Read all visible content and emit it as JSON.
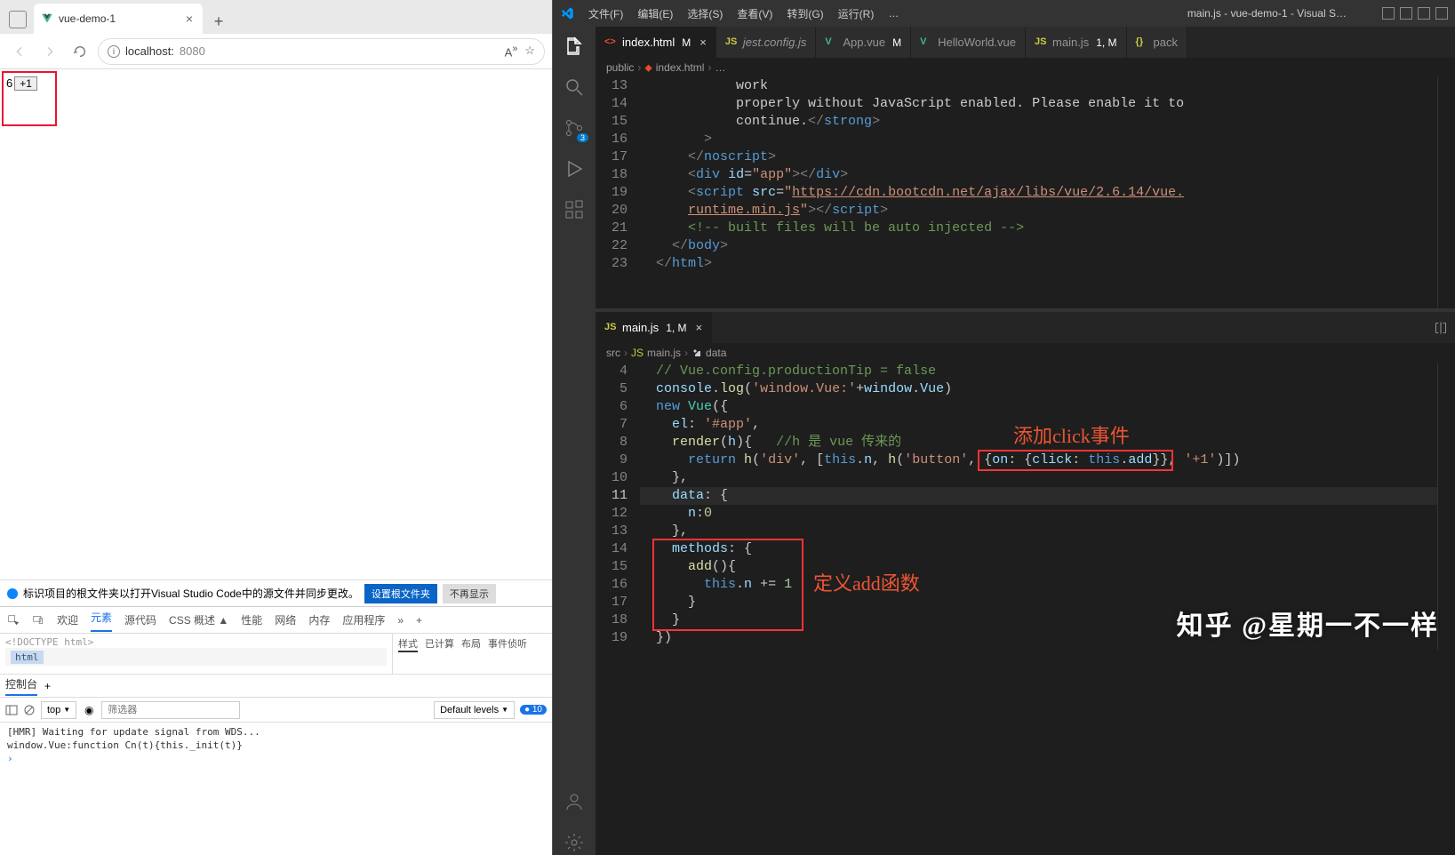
{
  "browser": {
    "tab_title": "vue-demo-1",
    "url_host": "localhost:",
    "url_port": "8080",
    "page_number": "6",
    "button_label": "+1",
    "info_text": "标识项目的根文件夹以打开Visual Studio Code中的源文件并同步更改。",
    "info_btn1": "设置根文件夹",
    "info_btn2": "不再显示",
    "devtabs": [
      "欢迎",
      "元素",
      "源代码",
      "CSS 概述 ▲",
      "性能",
      "网络",
      "内存",
      "应用程序"
    ],
    "doctype": "<!DOCTYPE html>",
    "breadcrumb": "html",
    "style_tabs": [
      "样式",
      "已计算",
      "布局",
      "事件侦听"
    ],
    "console_tab": "控制台",
    "top_filter": "top",
    "filter_placeholder": "筛选器",
    "levels": "Default levels",
    "issue_count": "10",
    "console_line1": "[HMR] Waiting for update signal from WDS...",
    "console_line2": "window.Vue:function Cn(t){this._init(t)}"
  },
  "vscode": {
    "menu": [
      "文件(F)",
      "编辑(E)",
      "选择(S)",
      "查看(V)",
      "转到(G)",
      "运行(R)",
      "…"
    ],
    "title": "main.js - vue-demo-1 - Visual S…",
    "scm_badge": "3",
    "pane1": {
      "tabs": [
        {
          "name": "index.html",
          "icon": "html",
          "modified": "M",
          "active": true,
          "close": true
        },
        {
          "name": "jest.config.js",
          "icon": "js",
          "italic": true
        },
        {
          "name": "App.vue",
          "icon": "vue",
          "modified": "M"
        },
        {
          "name": "HelloWorld.vue",
          "icon": "vue"
        },
        {
          "name": "main.js",
          "icon": "js",
          "modified": "1, M"
        },
        {
          "name": "pack",
          "icon": "json"
        }
      ],
      "breadcrumb": [
        "public",
        "index.html",
        "…"
      ],
      "lines": [
        {
          "n": 13,
          "html": "            work"
        },
        {
          "n": 14,
          "html": "            properly without JavaScript enabled. Please enable it to"
        },
        {
          "n": 15,
          "html": "            continue.<span class='c-pun'>&lt;/</span><span class='c-tag'>strong</span><span class='c-pun'>&gt;</span>"
        },
        {
          "n": 16,
          "html": "        <span class='c-pun'>&gt;</span>"
        },
        {
          "n": 17,
          "html": "      <span class='c-pun'>&lt;/</span><span class='c-tag'>noscript</span><span class='c-pun'>&gt;</span>"
        },
        {
          "n": 18,
          "html": "      <span class='c-pun'>&lt;</span><span class='c-tag'>div</span> <span class='c-attr'>id</span>=<span class='c-str'>\"app\"</span><span class='c-pun'>&gt;&lt;/</span><span class='c-tag'>div</span><span class='c-pun'>&gt;</span>"
        },
        {
          "n": 19,
          "html": "      <span class='c-pun'>&lt;</span><span class='c-tag'>script</span> <span class='c-attr'>src</span>=<span class='c-str'>\"<u>https://cdn.bootcdn.net/ajax/libs/vue/2.6.14/vue.</u></span>"
        },
        {
          "n": "",
          "html": "      <span class='c-str'><u>runtime.min.js</u>\"</span><span class='c-pun'>&gt;&lt;/</span><span class='c-tag'>script</span><span class='c-pun'>&gt;</span>"
        },
        {
          "n": 20,
          "html": "      <span class='c-cm'>&lt;!-- built files will be auto injected --&gt;</span>"
        },
        {
          "n": 21,
          "html": "    <span class='c-pun'>&lt;/</span><span class='c-tag'>body</span><span class='c-pun'>&gt;</span>"
        },
        {
          "n": 22,
          "html": "  <span class='c-pun'>&lt;/</span><span class='c-tag'>html</span><span class='c-pun'>&gt;</span>"
        },
        {
          "n": 23,
          "html": ""
        }
      ]
    },
    "pane2": {
      "tabs": [
        {
          "name": "main.js",
          "icon": "js",
          "modified": "1, M",
          "active": true,
          "close": true
        }
      ],
      "breadcrumb": [
        "src",
        "main.js",
        "data"
      ],
      "lines": [
        {
          "n": 4,
          "html": "  <span class='c-cm'>// Vue.config.productionTip = false</span>"
        },
        {
          "n": 5,
          "html": "  <span class='c-prop'>console</span>.<span class='c-fn'>log</span>(<span class='c-str'>'window.Vue:'</span>+<span class='c-prop'>window</span>.<span class='c-prop'>Vue</span>)"
        },
        {
          "n": 6,
          "html": "  <span class='c-kw'>new</span> <span class='c-cls'>Vue</span>({"
        },
        {
          "n": 7,
          "html": "    <span class='c-prop'>el</span>: <span class='c-str'>'#app'</span>,"
        },
        {
          "n": 8,
          "html": "    <span class='c-fn'>render</span>(<span class='c-prop'>h</span>){   <span class='c-cm'>//h 是 vue 传来的</span>"
        },
        {
          "n": 9,
          "html": "      <span class='c-kw'>return</span> <span class='c-fn'>h</span>(<span class='c-str'>'div'</span>, [<span class='c-this'>this</span>.<span class='c-prop'>n</span>, <span class='c-fn'>h</span>(<span class='c-str'>'button'</span>, {<span class='c-prop'>on</span>: {<span class='c-prop'>click</span>: <span class='c-this'>this</span>.<span class='c-prop'>add</span>}}, <span class='c-str'>'+1'</span>)])"
        },
        {
          "n": 10,
          "html": "    },"
        },
        {
          "n": 11,
          "hl": true,
          "html": "    <span class='c-prop'>data</span>: {"
        },
        {
          "n": 12,
          "html": "      <span class='c-prop'>n</span>:<span class='c-num'>0</span>"
        },
        {
          "n": 13,
          "html": "    },"
        },
        {
          "n": 14,
          "html": "    <span class='c-prop'>methods</span>: {"
        },
        {
          "n": 15,
          "html": "      <span class='c-fn'>add</span>(){"
        },
        {
          "n": 16,
          "html": "        <span class='c-this'>this</span>.<span class='c-prop'>n</span> += <span class='c-num'>1</span>"
        },
        {
          "n": 17,
          "html": "      }"
        },
        {
          "n": 18,
          "html": "    }"
        },
        {
          "n": 19,
          "html": "  })"
        }
      ]
    },
    "anno1_text": "添加click事件",
    "anno2_text": "定义add函数",
    "watermark": "知乎 @星期一不一样"
  }
}
